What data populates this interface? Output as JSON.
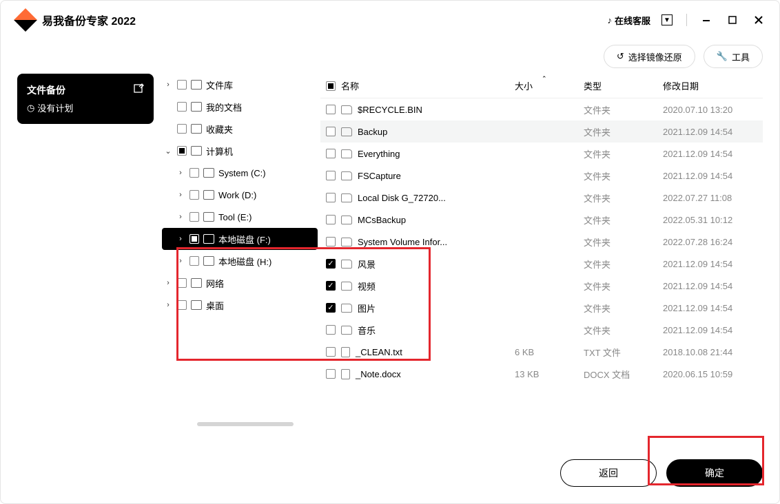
{
  "app": {
    "title": "易我备份专家 2022",
    "service": "在线客服"
  },
  "toolbar": {
    "restore": "选择镜像还原",
    "tools": "工具"
  },
  "task": {
    "title": "文件备份",
    "status": "没有计划"
  },
  "tree": [
    {
      "label": "文件库",
      "chev": "›",
      "indent": 0,
      "cb": "",
      "icon": "folder"
    },
    {
      "label": "我的文档",
      "chev": "",
      "indent": 0,
      "cb": "",
      "icon": "folder"
    },
    {
      "label": "收藏夹",
      "chev": "",
      "indent": 0,
      "cb": "",
      "icon": "folder"
    },
    {
      "label": "计算机",
      "chev": "⌄",
      "indent": 0,
      "cb": "partial",
      "icon": "pc"
    },
    {
      "label": "System (C:)",
      "chev": "›",
      "indent": 1,
      "cb": "",
      "icon": "disk"
    },
    {
      "label": "Work (D:)",
      "chev": "›",
      "indent": 1,
      "cb": "",
      "icon": "disk"
    },
    {
      "label": "Tool (E:)",
      "chev": "›",
      "indent": 1,
      "cb": "",
      "icon": "disk"
    },
    {
      "label": "本地磁盘 (F:)",
      "chev": "›",
      "indent": 1,
      "cb": "partial",
      "icon": "disk",
      "selected": true
    },
    {
      "label": "本地磁盘 (H:)",
      "chev": "›",
      "indent": 1,
      "cb": "",
      "icon": "disk"
    },
    {
      "label": "网络",
      "chev": "›",
      "indent": 0,
      "cb": "",
      "icon": "net"
    },
    {
      "label": "桌面",
      "chev": "›",
      "indent": 0,
      "cb": "",
      "icon": "desk"
    }
  ],
  "columns": {
    "name": "名称",
    "size": "大小",
    "type": "类型",
    "date": "修改日期"
  },
  "files": [
    {
      "name": "$RECYCLE.BIN",
      "size": "",
      "type": "文件夹",
      "date": "2020.07.10 13:20",
      "chk": false,
      "icon": "folder"
    },
    {
      "name": "Backup",
      "size": "",
      "type": "文件夹",
      "date": "2021.12.09 14:54",
      "chk": false,
      "icon": "folder",
      "sel": true
    },
    {
      "name": "Everything",
      "size": "",
      "type": "文件夹",
      "date": "2021.12.09 14:54",
      "chk": false,
      "icon": "folder"
    },
    {
      "name": "FSCapture",
      "size": "",
      "type": "文件夹",
      "date": "2021.12.09 14:54",
      "chk": false,
      "icon": "folder"
    },
    {
      "name": "Local Disk G_72720...",
      "size": "",
      "type": "文件夹",
      "date": "2022.07.27 11:08",
      "chk": false,
      "icon": "folder"
    },
    {
      "name": "MCsBackup",
      "size": "",
      "type": "文件夹",
      "date": "2022.05.31 10:12",
      "chk": false,
      "icon": "folder"
    },
    {
      "name": "System Volume Infor...",
      "size": "",
      "type": "文件夹",
      "date": "2022.07.28 16:24",
      "chk": false,
      "icon": "folder"
    },
    {
      "name": "风景",
      "size": "",
      "type": "文件夹",
      "date": "2021.12.09 14:54",
      "chk": true,
      "icon": "folder"
    },
    {
      "name": "视频",
      "size": "",
      "type": "文件夹",
      "date": "2021.12.09 14:54",
      "chk": true,
      "icon": "folder"
    },
    {
      "name": "图片",
      "size": "",
      "type": "文件夹",
      "date": "2021.12.09 14:54",
      "chk": true,
      "icon": "folder"
    },
    {
      "name": "音乐",
      "size": "",
      "type": "文件夹",
      "date": "2021.12.09 14:54",
      "chk": false,
      "icon": "folder"
    },
    {
      "name": "_CLEAN.txt",
      "size": "6 KB",
      "type": "TXT 文件",
      "date": "2018.10.08 21:44",
      "chk": false,
      "icon": "file"
    },
    {
      "name": "_Note.docx",
      "size": "13 KB",
      "type": "DOCX 文档",
      "date": "2020.06.15 10:59",
      "chk": false,
      "icon": "file"
    }
  ],
  "footer": {
    "back": "返回",
    "ok": "确定"
  }
}
